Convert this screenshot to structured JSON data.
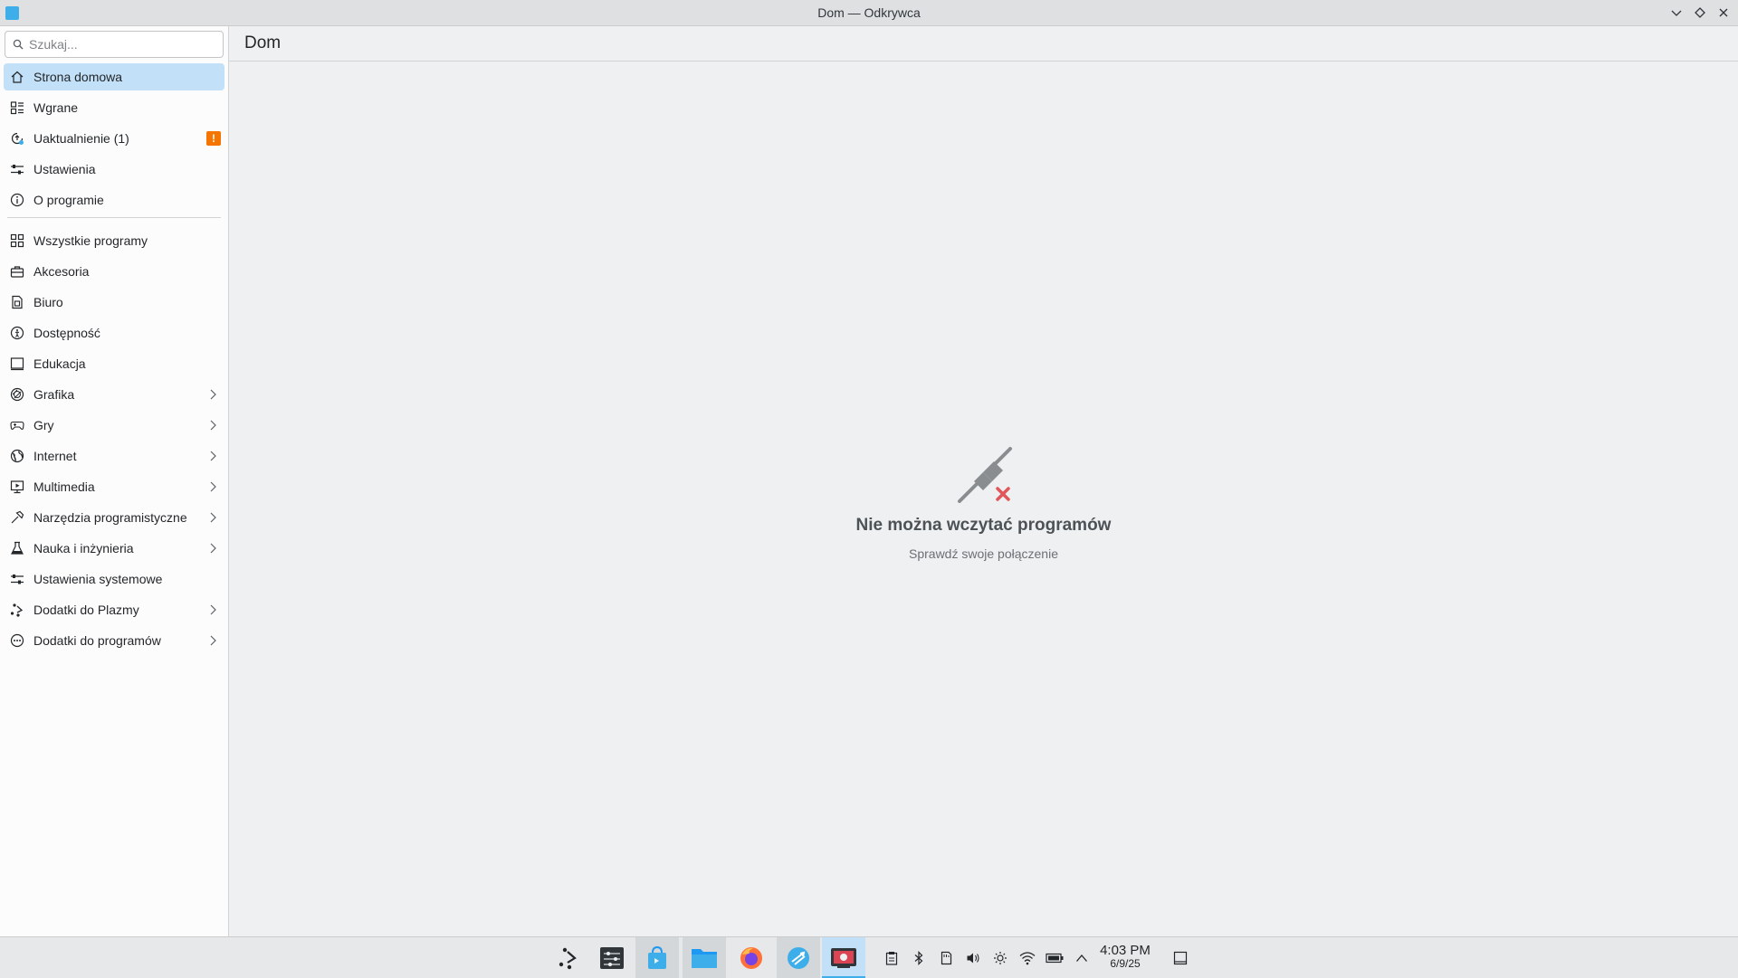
{
  "window": {
    "title": "Dom — Odkrywca"
  },
  "search": {
    "placeholder": "Szukaj..."
  },
  "sidebar": {
    "primary": [
      {
        "label": "Strona domowa",
        "icon": "home-icon",
        "active": true
      },
      {
        "label": "Wgrane",
        "icon": "installed-list-icon"
      },
      {
        "label": "Uaktualnienie (1)",
        "icon": "update-icon",
        "badge": "!"
      },
      {
        "label": "Ustawienia",
        "icon": "settings-sliders-icon"
      },
      {
        "label": "O programie",
        "icon": "info-icon"
      }
    ],
    "categories": [
      {
        "label": "Wszystkie programy",
        "icon": "grid-icon"
      },
      {
        "label": "Akcesoria",
        "icon": "toolbox-icon"
      },
      {
        "label": "Biuro",
        "icon": "office-icon"
      },
      {
        "label": "Dostępność",
        "icon": "accessibility-icon"
      },
      {
        "label": "Edukacja",
        "icon": "education-icon"
      },
      {
        "label": "Grafika",
        "icon": "graphics-icon",
        "has_children": true
      },
      {
        "label": "Gry",
        "icon": "gamepad-icon",
        "has_children": true
      },
      {
        "label": "Internet",
        "icon": "globe-icon",
        "has_children": true
      },
      {
        "label": "Multimedia",
        "icon": "monitor-icon",
        "has_children": true
      },
      {
        "label": "Narzędzia programistyczne",
        "icon": "hammer-icon",
        "has_children": true
      },
      {
        "label": "Nauka i inżynieria",
        "icon": "flask-icon",
        "has_children": true
      },
      {
        "label": "Ustawienia systemowe",
        "icon": "system-settings-icon"
      },
      {
        "label": "Dodatki do Plazmy",
        "icon": "plasma-icon",
        "has_children": true
      },
      {
        "label": "Dodatki do programów",
        "icon": "addons-icon",
        "has_children": true
      }
    ]
  },
  "header": {
    "title": "Dom"
  },
  "main": {
    "error_title": "Nie można wczytać programów",
    "error_subtitle": "Sprawdź swoje połączenie"
  },
  "taskbar": {
    "apps": [
      {
        "name": "plasma-launcher"
      },
      {
        "name": "system-monitor"
      },
      {
        "name": "discover"
      },
      {
        "name": "file-manager"
      },
      {
        "name": "firefox"
      },
      {
        "name": "kde-connect"
      },
      {
        "name": "spectacle"
      }
    ],
    "clock": {
      "time": "4:03 PM",
      "date": "6/9/25"
    }
  },
  "colors": {
    "accent": "#3daee9",
    "selection": "#c2e1f8",
    "badge": "#f67400",
    "error_x": "#e0565b"
  }
}
